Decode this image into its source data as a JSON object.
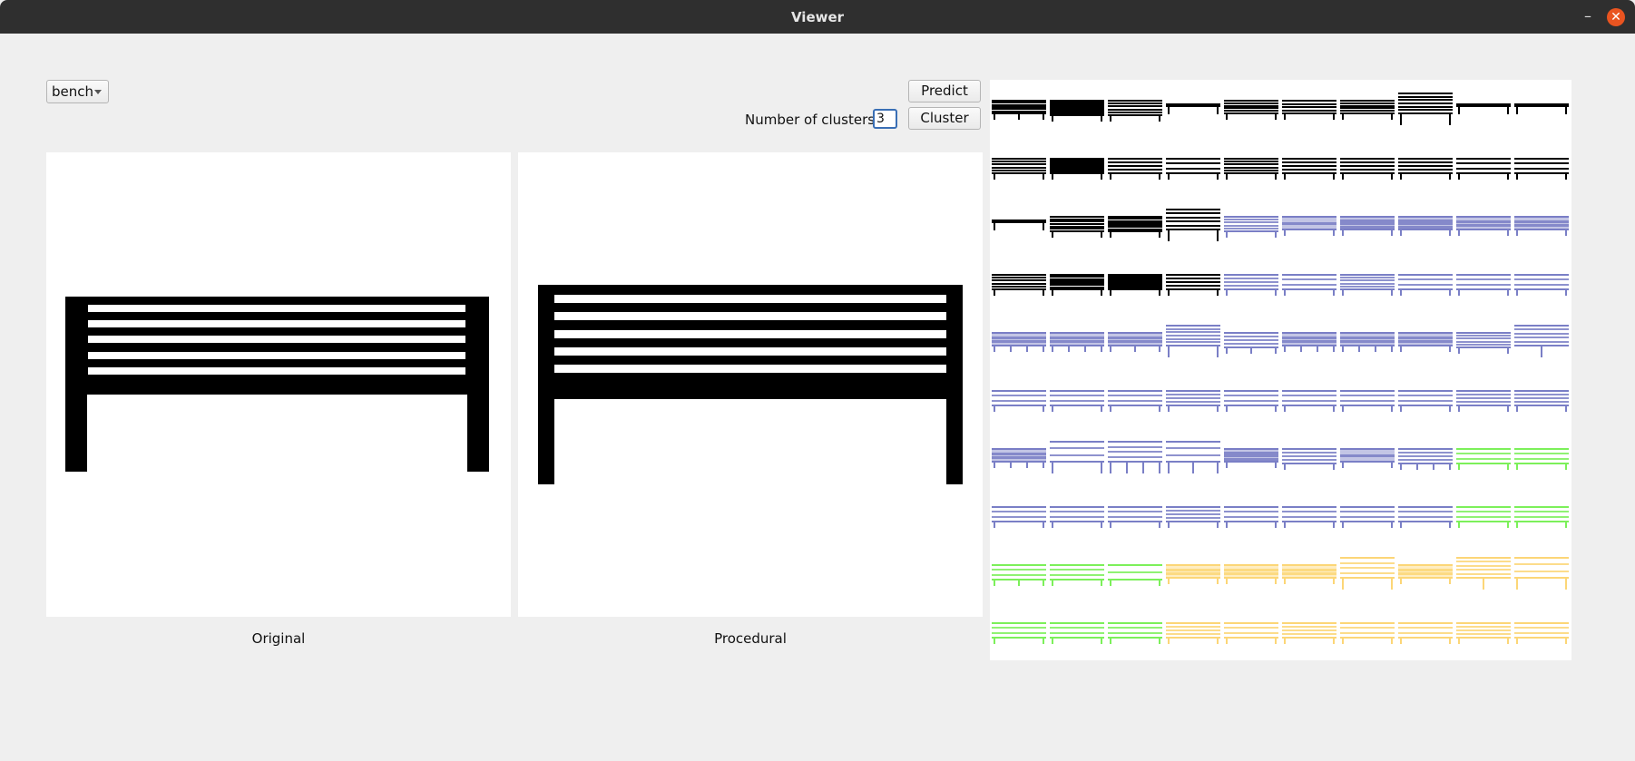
{
  "window": {
    "title": "Viewer"
  },
  "controls": {
    "category": "bench",
    "predict_label": "Predict",
    "clusters_label": "Number of clusters:",
    "clusters_value": "3",
    "cluster_label": "Cluster"
  },
  "panels": {
    "original_caption": "Original",
    "procedural_caption": "Procedural"
  },
  "colors": {
    "black": "#000000",
    "blue": "#7a7fc6",
    "green": "#7cf05a",
    "yellow": "#fcd677"
  },
  "grid": {
    "rows": [
      [
        {
          "style": "seat",
          "color": "black",
          "slats": 5,
          "legs": 3
        },
        {
          "style": "back",
          "color": "black",
          "slats": 7,
          "legs": 2
        },
        {
          "style": "back",
          "color": "black",
          "slats": 4,
          "legs": 2
        },
        {
          "style": "table",
          "color": "black",
          "slats": 1,
          "legs": 2
        },
        {
          "style": "seat",
          "color": "black",
          "slats": 4,
          "legs": 2
        },
        {
          "style": "seat",
          "color": "black",
          "slats": 3,
          "legs": 2
        },
        {
          "style": "seat",
          "color": "black",
          "slats": 4,
          "legs": 2
        },
        {
          "style": "tall",
          "color": "black",
          "slats": 5,
          "legs": 2
        },
        {
          "style": "table",
          "color": "black",
          "slats": 1,
          "legs": 2
        },
        {
          "style": "table",
          "color": "black",
          "slats": 1,
          "legs": 2
        }
      ],
      [
        {
          "style": "back",
          "color": "black",
          "slats": 4,
          "legs": 2
        },
        {
          "style": "back",
          "color": "black",
          "slats": 7,
          "legs": 2
        },
        {
          "style": "back",
          "color": "black",
          "slats": 3,
          "legs": 2
        },
        {
          "style": "back",
          "color": "black",
          "slats": 2,
          "legs": 2
        },
        {
          "style": "back",
          "color": "black",
          "slats": 4,
          "legs": 2
        },
        {
          "style": "back",
          "color": "black",
          "slats": 3,
          "legs": 2
        },
        {
          "style": "back",
          "color": "black",
          "slats": 3,
          "legs": 2
        },
        {
          "style": "back",
          "color": "black",
          "slats": 3,
          "legs": 2
        },
        {
          "style": "back",
          "color": "black",
          "slats": 2,
          "legs": 2
        },
        {
          "style": "back",
          "color": "black",
          "slats": 2,
          "legs": 2
        }
      ],
      [
        {
          "style": "table",
          "color": "black",
          "slats": 1,
          "legs": 2
        },
        {
          "style": "back",
          "color": "black",
          "slats": 5,
          "legs": 2
        },
        {
          "style": "back",
          "color": "black",
          "slats": 6,
          "legs": 2
        },
        {
          "style": "tall",
          "color": "black",
          "slats": 4,
          "legs": 2
        },
        {
          "style": "back",
          "color": "blue",
          "slats": 4,
          "legs": 2
        },
        {
          "style": "seat",
          "color": "blue",
          "slats": 1,
          "legs": 2
        },
        {
          "style": "seat",
          "color": "blue",
          "slats": 3,
          "legs": 2
        },
        {
          "style": "seat",
          "color": "blue",
          "slats": 3,
          "legs": 2
        },
        {
          "style": "seat",
          "color": "blue",
          "slats": 2,
          "legs": 2
        },
        {
          "style": "seat",
          "color": "blue",
          "slats": 2,
          "legs": 2
        }
      ],
      [
        {
          "style": "back",
          "color": "black",
          "slats": 4,
          "legs": 2
        },
        {
          "style": "back",
          "color": "black",
          "slats": 6,
          "legs": 2
        },
        {
          "style": "back",
          "color": "black",
          "slats": 8,
          "legs": 2
        },
        {
          "style": "back",
          "color": "black",
          "slats": 3,
          "legs": 2
        },
        {
          "style": "back",
          "color": "blue",
          "slats": 3,
          "legs": 2
        },
        {
          "style": "back",
          "color": "blue",
          "slats": 2,
          "legs": 2
        },
        {
          "style": "back",
          "color": "blue",
          "slats": 4,
          "legs": 2
        },
        {
          "style": "back",
          "color": "blue",
          "slats": 2,
          "legs": 2
        },
        {
          "style": "back",
          "color": "blue",
          "slats": 2,
          "legs": 2
        },
        {
          "style": "back",
          "color": "blue",
          "slats": 2,
          "legs": 2
        }
      ],
      [
        {
          "style": "seat",
          "color": "blue",
          "slats": 2,
          "legs": 4
        },
        {
          "style": "seat",
          "color": "blue",
          "slats": 2,
          "legs": 4
        },
        {
          "style": "seat",
          "color": "blue",
          "slats": 2,
          "legs": 3
        },
        {
          "style": "tall",
          "color": "blue",
          "slats": 5,
          "legs": 2
        },
        {
          "style": "back",
          "color": "blue",
          "slats": 3,
          "legs": 3
        },
        {
          "style": "seat",
          "color": "blue",
          "slats": 2,
          "legs": 4
        },
        {
          "style": "seat",
          "color": "blue",
          "slats": 2,
          "legs": 4
        },
        {
          "style": "seat",
          "color": "blue",
          "slats": 2,
          "legs": 2
        },
        {
          "style": "back",
          "color": "blue",
          "slats": 4,
          "legs": 2
        },
        {
          "style": "tall",
          "color": "blue",
          "slats": 4,
          "legs": 1
        }
      ],
      [
        {
          "style": "back",
          "color": "blue",
          "slats": 2,
          "legs": 2
        },
        {
          "style": "back",
          "color": "blue",
          "slats": 2,
          "legs": 2
        },
        {
          "style": "back",
          "color": "blue",
          "slats": 2,
          "legs": 2
        },
        {
          "style": "back",
          "color": "blue",
          "slats": 3,
          "legs": 2
        },
        {
          "style": "back",
          "color": "blue",
          "slats": 2,
          "legs": 2
        },
        {
          "style": "back",
          "color": "blue",
          "slats": 2,
          "legs": 2
        },
        {
          "style": "back",
          "color": "blue",
          "slats": 2,
          "legs": 2
        },
        {
          "style": "back",
          "color": "blue",
          "slats": 2,
          "legs": 2
        },
        {
          "style": "back",
          "color": "blue",
          "slats": 3,
          "legs": 2
        },
        {
          "style": "back",
          "color": "blue",
          "slats": 3,
          "legs": 2
        }
      ],
      [
        {
          "style": "seat",
          "color": "blue",
          "slats": 2,
          "legs": 4
        },
        {
          "style": "tall",
          "color": "blue",
          "slats": 2,
          "legs": 2
        },
        {
          "style": "tall",
          "color": "blue",
          "slats": 3,
          "legs": 4
        },
        {
          "style": "tall",
          "color": "blue",
          "slats": 2,
          "legs": 3
        },
        {
          "style": "seat",
          "color": "blue",
          "slats": 3,
          "legs": 2
        },
        {
          "style": "back",
          "color": "blue",
          "slats": 3,
          "legs": 2
        },
        {
          "style": "seat",
          "color": "blue",
          "slats": 1,
          "legs": 2
        },
        {
          "style": "back",
          "color": "blue",
          "slats": 3,
          "legs": 4
        },
        {
          "style": "back",
          "color": "green",
          "slats": 2,
          "legs": 2
        },
        {
          "style": "back",
          "color": "green",
          "slats": 2,
          "legs": 2
        }
      ],
      [
        {
          "style": "back",
          "color": "blue",
          "slats": 2,
          "legs": 2
        },
        {
          "style": "back",
          "color": "blue",
          "slats": 2,
          "legs": 2
        },
        {
          "style": "back",
          "color": "blue",
          "slats": 2,
          "legs": 2
        },
        {
          "style": "back",
          "color": "blue",
          "slats": 3,
          "legs": 2
        },
        {
          "style": "back",
          "color": "blue",
          "slats": 2,
          "legs": 2
        },
        {
          "style": "back",
          "color": "blue",
          "slats": 2,
          "legs": 2
        },
        {
          "style": "back",
          "color": "blue",
          "slats": 2,
          "legs": 2
        },
        {
          "style": "back",
          "color": "blue",
          "slats": 2,
          "legs": 2
        },
        {
          "style": "back",
          "color": "green",
          "slats": 2,
          "legs": 2
        },
        {
          "style": "back",
          "color": "green",
          "slats": 2,
          "legs": 2
        }
      ],
      [
        {
          "style": "back",
          "color": "green",
          "slats": 2,
          "legs": 3
        },
        {
          "style": "back",
          "color": "green",
          "slats": 2,
          "legs": 2
        },
        {
          "style": "back",
          "color": "green",
          "slats": 1,
          "legs": 2
        },
        {
          "style": "seat",
          "color": "yellow",
          "slats": 2,
          "legs": 2
        },
        {
          "style": "seat",
          "color": "yellow",
          "slats": 2,
          "legs": 2
        },
        {
          "style": "seat",
          "color": "yellow",
          "slats": 2,
          "legs": 2
        },
        {
          "style": "tall",
          "color": "yellow",
          "slats": 3,
          "legs": 2
        },
        {
          "style": "seat",
          "color": "yellow",
          "slats": 2,
          "legs": 2
        },
        {
          "style": "tall",
          "color": "yellow",
          "slats": 4,
          "legs": 1
        },
        {
          "style": "tall",
          "color": "yellow",
          "slats": 2,
          "legs": 2
        }
      ],
      [
        {
          "style": "back",
          "color": "green",
          "slats": 2,
          "legs": 2
        },
        {
          "style": "back",
          "color": "green",
          "slats": 2,
          "legs": 2
        },
        {
          "style": "back",
          "color": "green",
          "slats": 2,
          "legs": 2
        },
        {
          "style": "back",
          "color": "yellow",
          "slats": 3,
          "legs": 2
        },
        {
          "style": "back",
          "color": "yellow",
          "slats": 2,
          "legs": 2
        },
        {
          "style": "back",
          "color": "yellow",
          "slats": 3,
          "legs": 2
        },
        {
          "style": "back",
          "color": "yellow",
          "slats": 2,
          "legs": 2
        },
        {
          "style": "back",
          "color": "yellow",
          "slats": 2,
          "legs": 2
        },
        {
          "style": "back",
          "color": "yellow",
          "slats": 3,
          "legs": 2
        },
        {
          "style": "back",
          "color": "yellow",
          "slats": 2,
          "legs": 2
        }
      ]
    ]
  }
}
